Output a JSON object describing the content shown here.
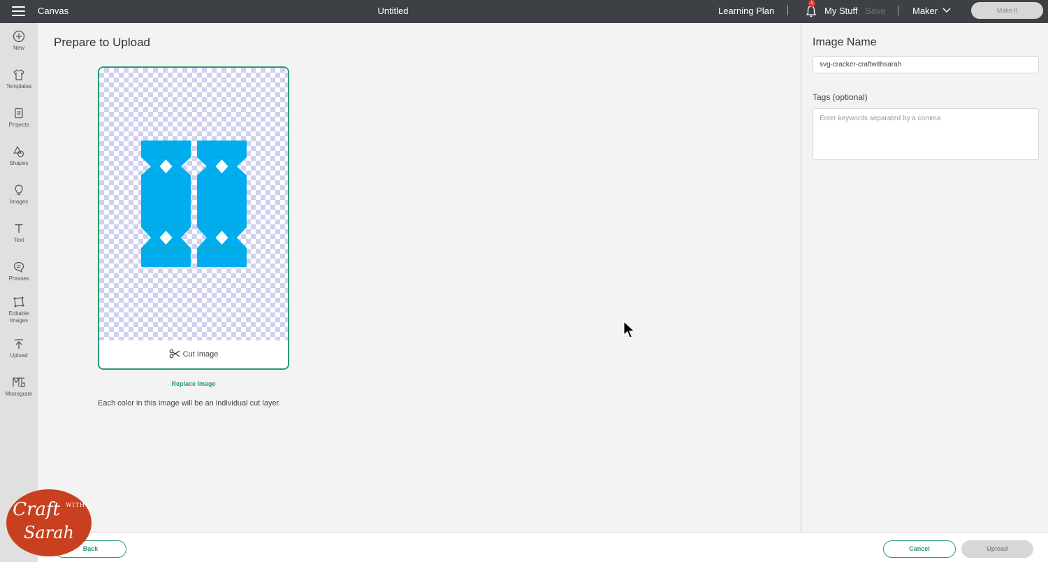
{
  "topbar": {
    "app_name": "Canvas",
    "doc_title": "Untitled",
    "learning_plan": "Learning Plan",
    "notification_count": "1",
    "my_stuff": "My Stuff",
    "save": "Save",
    "machine": "Maker",
    "make_it": "Make It"
  },
  "sidebar": {
    "items": [
      {
        "label": "New",
        "icon": "plus-circle-icon"
      },
      {
        "label": "Templates",
        "icon": "shirt-icon"
      },
      {
        "label": "Projects",
        "icon": "projects-icon"
      },
      {
        "label": "Shapes",
        "icon": "shapes-icon"
      },
      {
        "label": "Images",
        "icon": "lightbulb-icon"
      },
      {
        "label": "Text",
        "icon": "text-icon"
      },
      {
        "label": "Phrases",
        "icon": "speech-bubble-icon"
      },
      {
        "label": "Editable Images",
        "icon": "editable-image-icon"
      },
      {
        "label": "Upload",
        "icon": "upload-icon"
      },
      {
        "label": "Monogram",
        "icon": "monogram-icon"
      }
    ]
  },
  "main": {
    "title": "Prepare to Upload",
    "cut_image_label": "Cut Image",
    "replace_image": "Replace Image",
    "note": "Each color in this image will be an individual cut layer.",
    "image_fill": "#00aeef",
    "accent": "#2a9b6f"
  },
  "right_panel": {
    "image_name_title": "Image Name",
    "image_name_value": "svg-cracker-craftwithsarah",
    "tags_label": "Tags (optional)",
    "tags_placeholder": "Enter keywords separated by a comma"
  },
  "footer": {
    "back": "Back",
    "cancel": "Cancel",
    "upload": "Upload"
  },
  "watermark": {
    "line1": "Craft",
    "with": "WITH",
    "line2": "Sarah"
  }
}
